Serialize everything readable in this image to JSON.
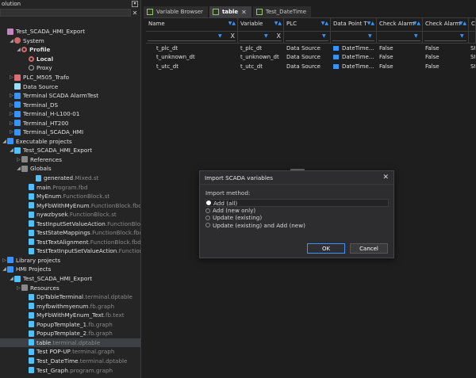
{
  "solution": {
    "title": "olution",
    "tree": [
      {
        "indent": 0,
        "tw": "",
        "icon": "i-sln",
        "label": "Test_SCADA_HMI_Export",
        "name": "solution-root"
      },
      {
        "indent": 1,
        "tw": "◢",
        "icon": "i-cfg",
        "label": "System",
        "name": "tree-system"
      },
      {
        "indent": 2,
        "tw": "◢",
        "icon": "i-gear",
        "label": "Profile",
        "bold": true,
        "name": "tree-profile"
      },
      {
        "indent": 3,
        "tw": "",
        "icon": "i-gear",
        "label": "Local",
        "bold": true,
        "name": "tree-local"
      },
      {
        "indent": 3,
        "tw": "",
        "icon": "i-proxy",
        "label": "Proxy",
        "name": "tree-proxy"
      },
      {
        "indent": 1,
        "tw": "▷",
        "icon": "i-plc",
        "label": "PLC_M505_Trafo",
        "name": "tree-plc"
      },
      {
        "indent": 1,
        "tw": "",
        "icon": "i-ds",
        "label": "Data Source",
        "name": "tree-data-source"
      },
      {
        "indent": 1,
        "tw": "▷",
        "icon": "i-term",
        "label": "Terminal SCADA AlarmTest",
        "name": "tree-terminal-alarmtest"
      },
      {
        "indent": 1,
        "tw": "▷",
        "icon": "i-term",
        "label": "Terminal_DS",
        "name": "tree-terminal-ds"
      },
      {
        "indent": 1,
        "tw": "▷",
        "icon": "i-term",
        "label": "Terminal_H-L100-01",
        "name": "tree-terminal-hl100"
      },
      {
        "indent": 1,
        "tw": "▷",
        "icon": "i-term",
        "label": "Terminal_HT200",
        "name": "tree-terminal-ht200"
      },
      {
        "indent": 1,
        "tw": "▷",
        "icon": "i-term",
        "label": "Terminal_SCADA_HMI",
        "name": "tree-terminal-scada-hmi"
      },
      {
        "indent": 0,
        "tw": "◢",
        "icon": "i-lib",
        "label": "Executable projects",
        "name": "tree-executable-projects"
      },
      {
        "indent": 1,
        "tw": "◢",
        "icon": "i-proj",
        "label": "Test_SCADA_HMI_Export",
        "name": "tree-exec-project"
      },
      {
        "indent": 2,
        "tw": "▷",
        "icon": "i-gfold",
        "label": "References",
        "name": "tree-references"
      },
      {
        "indent": 2,
        "tw": "◢",
        "icon": "i-gfold",
        "label": "Globals",
        "name": "tree-globals"
      },
      {
        "indent": 4,
        "tw": "",
        "icon": "i-file",
        "label": "generated",
        "ext": ".Mixed.st",
        "name": "tree-generated"
      },
      {
        "indent": 3,
        "tw": "",
        "icon": "i-file",
        "label": "main",
        "ext": ".Program.fbd",
        "name": "tree-main"
      },
      {
        "indent": 3,
        "tw": "",
        "icon": "i-file",
        "label": "MyEnum",
        "ext": ".FunctionBlock.st",
        "name": "tree-myenum"
      },
      {
        "indent": 3,
        "tw": "",
        "icon": "i-file",
        "label": "MyFbWithMyEnum",
        "ext": ".FunctionBlock.fbd",
        "name": "tree-myfbwithmyenum"
      },
      {
        "indent": 3,
        "tw": "",
        "icon": "i-file",
        "label": "nywzbysek",
        "ext": ".FunctionBlock.st",
        "name": "tree-nywzbysek"
      },
      {
        "indent": 3,
        "tw": "",
        "icon": "i-file",
        "label": "TestInputSetValueAction",
        "ext": ".FunctionBlock.fb",
        "name": "tree-testinputsetvalueaction"
      },
      {
        "indent": 3,
        "tw": "",
        "icon": "i-file",
        "label": "TestStateMappings",
        "ext": ".FunctionBlock.fbd",
        "name": "tree-teststatemappings"
      },
      {
        "indent": 3,
        "tw": "",
        "icon": "i-file",
        "label": "TestTextAlignment",
        "ext": ".FunctionBlock.fbd",
        "name": "tree-testtextalignment"
      },
      {
        "indent": 3,
        "tw": "",
        "icon": "i-file",
        "label": "TestTextInputSetValueAction",
        "ext": ".FunctionBlo",
        "name": "tree-testtextinputsetvalueaction"
      },
      {
        "indent": 0,
        "tw": "▷",
        "icon": "i-lib",
        "label": "Library projects",
        "name": "tree-library-projects"
      },
      {
        "indent": 0,
        "tw": "◢",
        "icon": "i-lib",
        "label": "HMI Projects",
        "name": "tree-hmi-projects"
      },
      {
        "indent": 1,
        "tw": "◢",
        "icon": "i-proj",
        "label": "Test_SCADA_HMI_Export",
        "name": "tree-hmi-project"
      },
      {
        "indent": 2,
        "tw": "▷",
        "icon": "i-gfold",
        "label": "Resources",
        "name": "tree-resources"
      },
      {
        "indent": 3,
        "tw": "",
        "icon": "i-file",
        "label": "DpTableTerminal",
        "ext": ".terminal.dptable",
        "name": "tree-dptableterminal"
      },
      {
        "indent": 3,
        "tw": "",
        "icon": "i-file",
        "label": "myfbwithmyenum",
        "ext": ".fb.graph",
        "name": "tree-myfbwithmyenum-graph"
      },
      {
        "indent": 3,
        "tw": "",
        "icon": "i-file",
        "label": "MyFbWithMyEnum_Text",
        "ext": ".fb.text",
        "name": "tree-myfbwithmyenum-text"
      },
      {
        "indent": 3,
        "tw": "",
        "icon": "i-file",
        "label": "PopupTemplate_1",
        "ext": ".fb.graph",
        "name": "tree-popuptemplate1"
      },
      {
        "indent": 3,
        "tw": "",
        "icon": "i-file",
        "label": "PopupTemplate_2",
        "ext": ".fb.graph",
        "name": "tree-popuptemplate2"
      },
      {
        "indent": 3,
        "tw": "",
        "icon": "i-file",
        "label": "table",
        "ext": ".terminal.dptable",
        "sel": true,
        "name": "tree-table"
      },
      {
        "indent": 3,
        "tw": "",
        "icon": "i-file",
        "label": "Test POP-UP",
        "ext": ".terminal.graph",
        "name": "tree-test-popup"
      },
      {
        "indent": 3,
        "tw": "",
        "icon": "i-file",
        "label": "Test_DateTime",
        "ext": ".terminal.dptable",
        "name": "tree-test-datetime"
      },
      {
        "indent": 3,
        "tw": "",
        "icon": "i-file",
        "label": "Test_Graph",
        "ext": ".program.graph",
        "name": "tree-test-graph"
      }
    ]
  },
  "tabs": [
    {
      "label": "Variable Browser",
      "active": false,
      "name": "tab-variable-browser"
    },
    {
      "label": "table",
      "active": true,
      "name": "tab-table"
    },
    {
      "label": "Test_DateTime",
      "active": false,
      "name": "tab-test-datetime"
    }
  ],
  "grid": {
    "columns": [
      {
        "label": "Name",
        "w": 116
      },
      {
        "label": "Variable",
        "w": 58
      },
      {
        "label": "PLC",
        "w": 59
      },
      {
        "label": "Data Point T",
        "w": 58
      },
      {
        "label": "Check Alarm",
        "w": 58
      },
      {
        "label": "Check Alarm",
        "w": 58
      },
      {
        "label": "C",
        "w": 9
      }
    ],
    "rows": [
      [
        "t_plc_dt",
        "t_plc_dt",
        "Data Source",
        "DateTime...",
        "False",
        "False",
        "St"
      ],
      [
        "t_unknown_dt",
        "t_unknown_dt",
        "Data Source",
        "DateTime...",
        "False",
        "False",
        "St"
      ],
      [
        "t_utc_dt",
        "t_utc_dt",
        "Data Source",
        "DateTime...",
        "False",
        "False",
        "St"
      ]
    ]
  },
  "modal": {
    "title": "Import SCADA variables",
    "method_label": "Import method:",
    "options": [
      {
        "label": "Add (all)",
        "selected": true
      },
      {
        "label": "Add (new only)",
        "selected": false
      },
      {
        "label": "Update (existing)",
        "selected": false
      },
      {
        "label": "Update (existing) and Add (new)",
        "selected": false
      }
    ],
    "ok": "OK",
    "cancel": "Cancel"
  }
}
